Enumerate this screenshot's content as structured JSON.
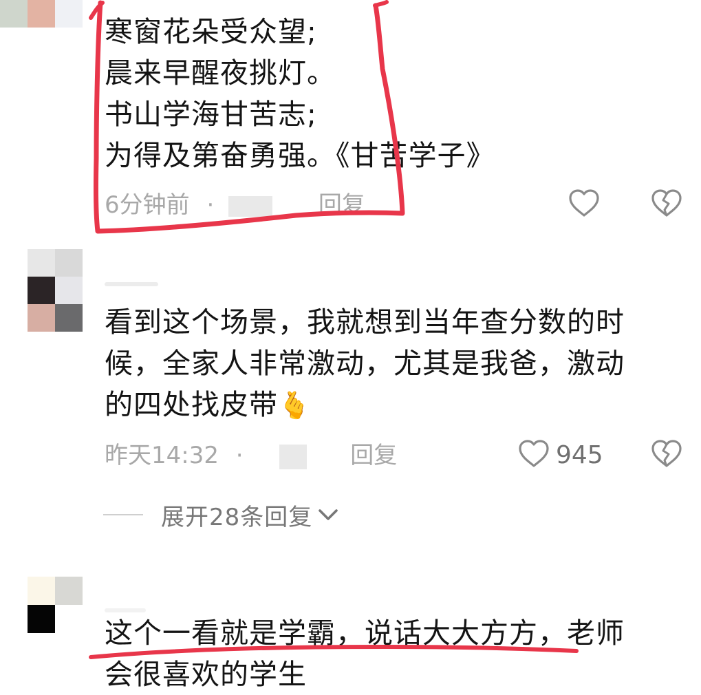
{
  "comments": [
    {
      "lines": [
        "寒窗花朵受众望;",
        "晨来早醒夜挑灯。",
        "书山学海甘苦志;",
        "为得及第奋勇强。《甘苦学子》"
      ],
      "time": "6分钟前",
      "separator": "·",
      "reply_label": "回复",
      "like_count": ""
    },
    {
      "lines": [
        "看到这个场景，我就想到当年查分数的时",
        "候，全家人非常激动，尤其是我爸，激动",
        "的四处找皮带"
      ],
      "emoji": "🫰",
      "time": "昨天14:32",
      "separator": "·",
      "reply_label": "回复",
      "like_count": "945",
      "expand_label": "展开28条回复"
    },
    {
      "lines": [
        "这个一看就是学霸，说话大大方方，老师",
        "会很喜欢的学生"
      ]
    }
  ],
  "icons": {
    "like": "heart-outline-icon",
    "dislike": "broken-heart-icon",
    "expand": "chevron-down-icon"
  },
  "colors": {
    "annotation": "#e8364a",
    "meta_text": "#a8a8a8",
    "body_text": "#141414"
  }
}
